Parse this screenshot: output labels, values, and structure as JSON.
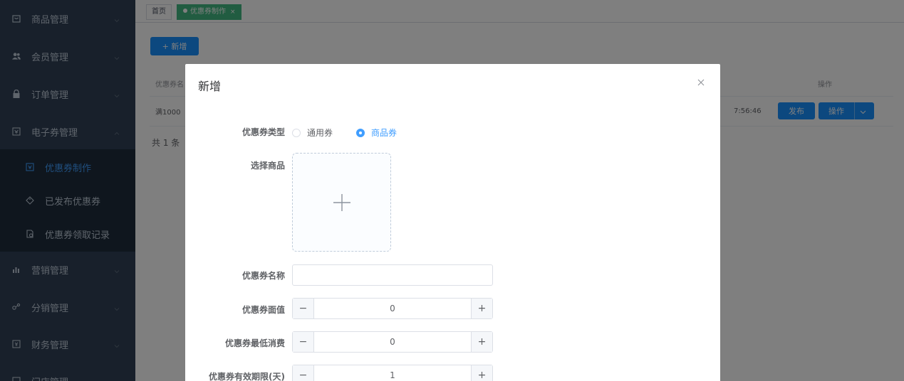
{
  "sidebar": {
    "items": [
      {
        "label": "商品管理",
        "icon": "shopping-bag-icon"
      },
      {
        "label": "会员管理",
        "icon": "users-icon"
      },
      {
        "label": "订单管理",
        "icon": "lock-icon"
      },
      {
        "label": "电子券管理",
        "icon": "ticket-icon",
        "expanded": true
      },
      {
        "label": "营销管理",
        "icon": "chart-icon"
      },
      {
        "label": "分销管理",
        "icon": "share-icon"
      },
      {
        "label": "财务管理",
        "icon": "finance-icon"
      },
      {
        "label": "门店管理",
        "icon": "store-icon"
      }
    ],
    "subitems": [
      {
        "label": "优惠券制作",
        "icon": "coupon-icon",
        "active": true
      },
      {
        "label": "已发布优惠券",
        "icon": "tag-icon"
      },
      {
        "label": "优惠券领取记录",
        "icon": "record-icon"
      }
    ]
  },
  "tabs": {
    "home": "首页",
    "current": "优惠券制作",
    "close": "×"
  },
  "toolbar": {
    "add_label": "+ 新增"
  },
  "table": {
    "col_name": "优惠券名",
    "col_action": "操作",
    "row_name": "满1000",
    "row_time": "7:56:46",
    "publish_label": "发布",
    "action_label": "操作"
  },
  "pagination": {
    "total": "共 1 条"
  },
  "dialog": {
    "title": "新增",
    "type_label": "优惠券类型",
    "type_options": [
      "通用券",
      "商品券"
    ],
    "selected_type": "商品券",
    "goods_label": "选择商品",
    "name_label": "优惠券名称",
    "name_value": "",
    "face_label": "优惠券面值",
    "face_value": "0",
    "min_label": "优惠券最低消费",
    "min_value": "0",
    "days_label": "优惠券有效期限(天)",
    "days_value": "1"
  },
  "colors": {
    "primary": "#1890ff",
    "tab_active": "#42b983",
    "sidebar_bg": "#304156",
    "sidebar_sub_bg": "#1f2d3d"
  }
}
